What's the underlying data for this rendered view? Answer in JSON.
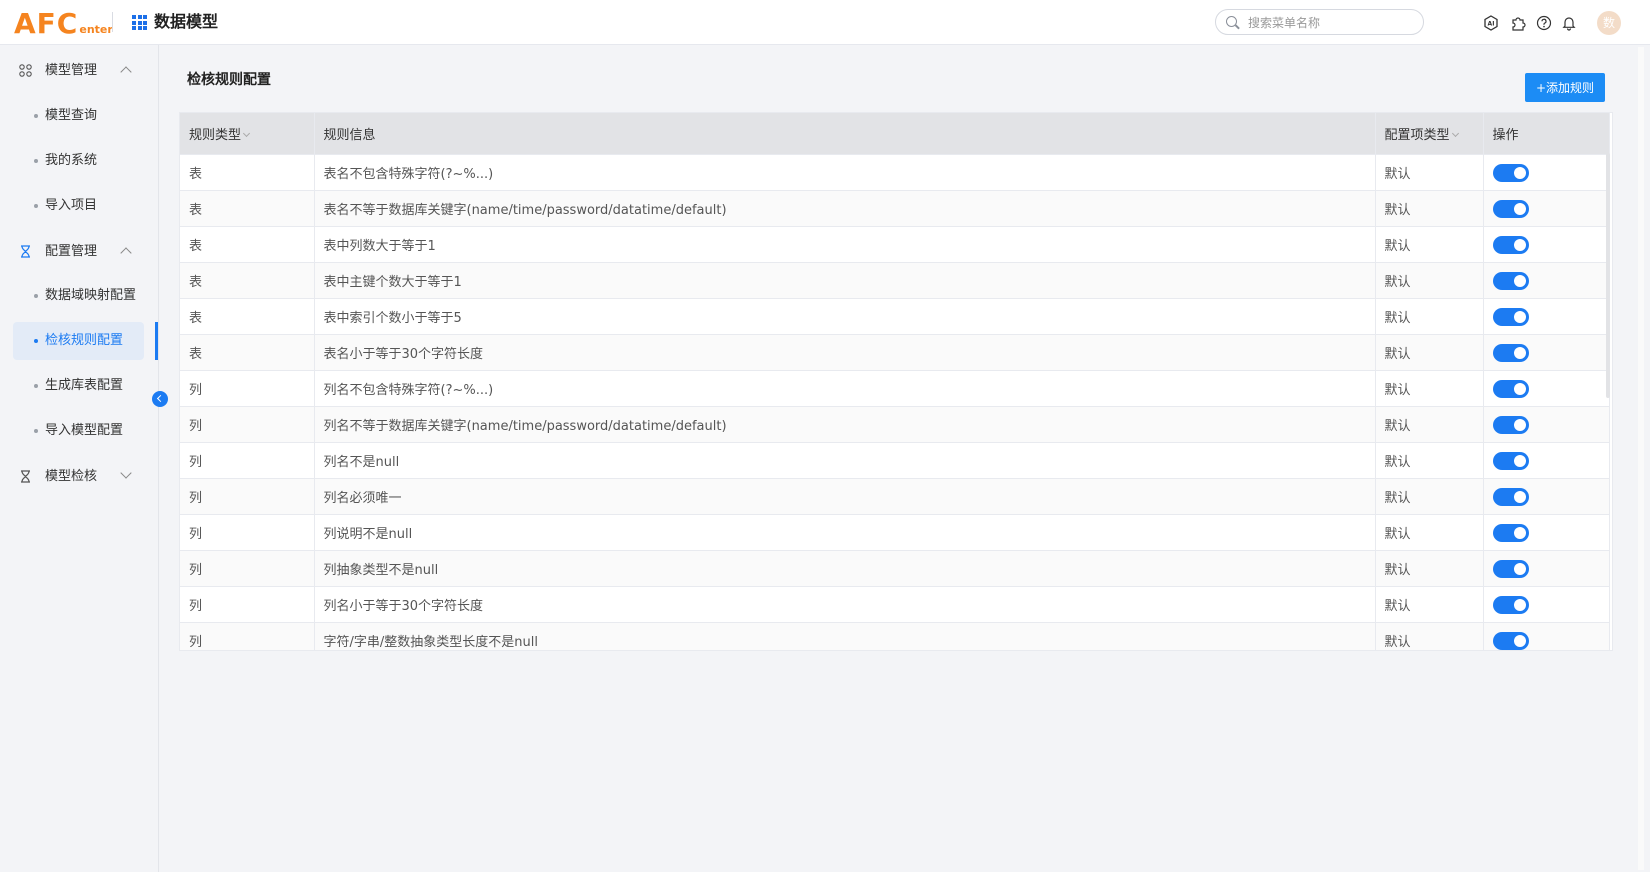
{
  "header": {
    "logo_main": "AFC",
    "logo_sub": "enter",
    "title": "数据模型",
    "search_placeholder": "搜索菜单名称",
    "icons": [
      "ai-icon",
      "puzzle-icon",
      "help-icon",
      "bell-icon"
    ],
    "avatar_text": "数"
  },
  "sidebar": {
    "groups": [
      {
        "label": "模型管理",
        "icon": "apps-icon",
        "expanded": true,
        "items": [
          "模型查询",
          "我的系统",
          "导入项目"
        ]
      },
      {
        "label": "配置管理",
        "icon": "hourglass-icon",
        "expanded": true,
        "items": [
          "数据域映射配置",
          "检核规则配置",
          "生成库表配置",
          "导入模型配置"
        ]
      },
      {
        "label": "模型检核",
        "icon": "hourglass-icon",
        "expanded": false,
        "items": []
      }
    ],
    "active_item": "检核规则配置"
  },
  "main": {
    "title": "检核规则配置",
    "add_button": "+添加规则",
    "table": {
      "columns": [
        "规则类型",
        "规则信息",
        "配置项类型",
        "操作"
      ],
      "rows": [
        {
          "type": "表",
          "info": "表名不包含特殊字符(?~%...)",
          "config": "默认",
          "enabled": true
        },
        {
          "type": "表",
          "info": "表名不等于数据库关键字(name/time/password/datatime/default)",
          "config": "默认",
          "enabled": true
        },
        {
          "type": "表",
          "info": "表中列数大于等于1",
          "config": "默认",
          "enabled": true
        },
        {
          "type": "表",
          "info": "表中主键个数大于等于1",
          "config": "默认",
          "enabled": true
        },
        {
          "type": "表",
          "info": "表中索引个数小于等于5",
          "config": "默认",
          "enabled": true
        },
        {
          "type": "表",
          "info": "表名小于等于30个字符长度",
          "config": "默认",
          "enabled": true
        },
        {
          "type": "列",
          "info": "列名不包含特殊字符(?~%...)",
          "config": "默认",
          "enabled": true
        },
        {
          "type": "列",
          "info": "列名不等于数据库关键字(name/time/password/datatime/default)",
          "config": "默认",
          "enabled": true
        },
        {
          "type": "列",
          "info": "列名不是null",
          "config": "默认",
          "enabled": true
        },
        {
          "type": "列",
          "info": "列名必须唯一",
          "config": "默认",
          "enabled": true
        },
        {
          "type": "列",
          "info": "列说明不是null",
          "config": "默认",
          "enabled": true
        },
        {
          "type": "列",
          "info": "列抽象类型不是null",
          "config": "默认",
          "enabled": true
        },
        {
          "type": "列",
          "info": "列名小于等于30个字符长度",
          "config": "默认",
          "enabled": true
        },
        {
          "type": "列",
          "info": "字符/字串/整数抽象类型长度不是null",
          "config": "默认",
          "enabled": true
        }
      ]
    }
  },
  "colors": {
    "primary": "#1c7bf2",
    "logo": "#f5841f"
  }
}
